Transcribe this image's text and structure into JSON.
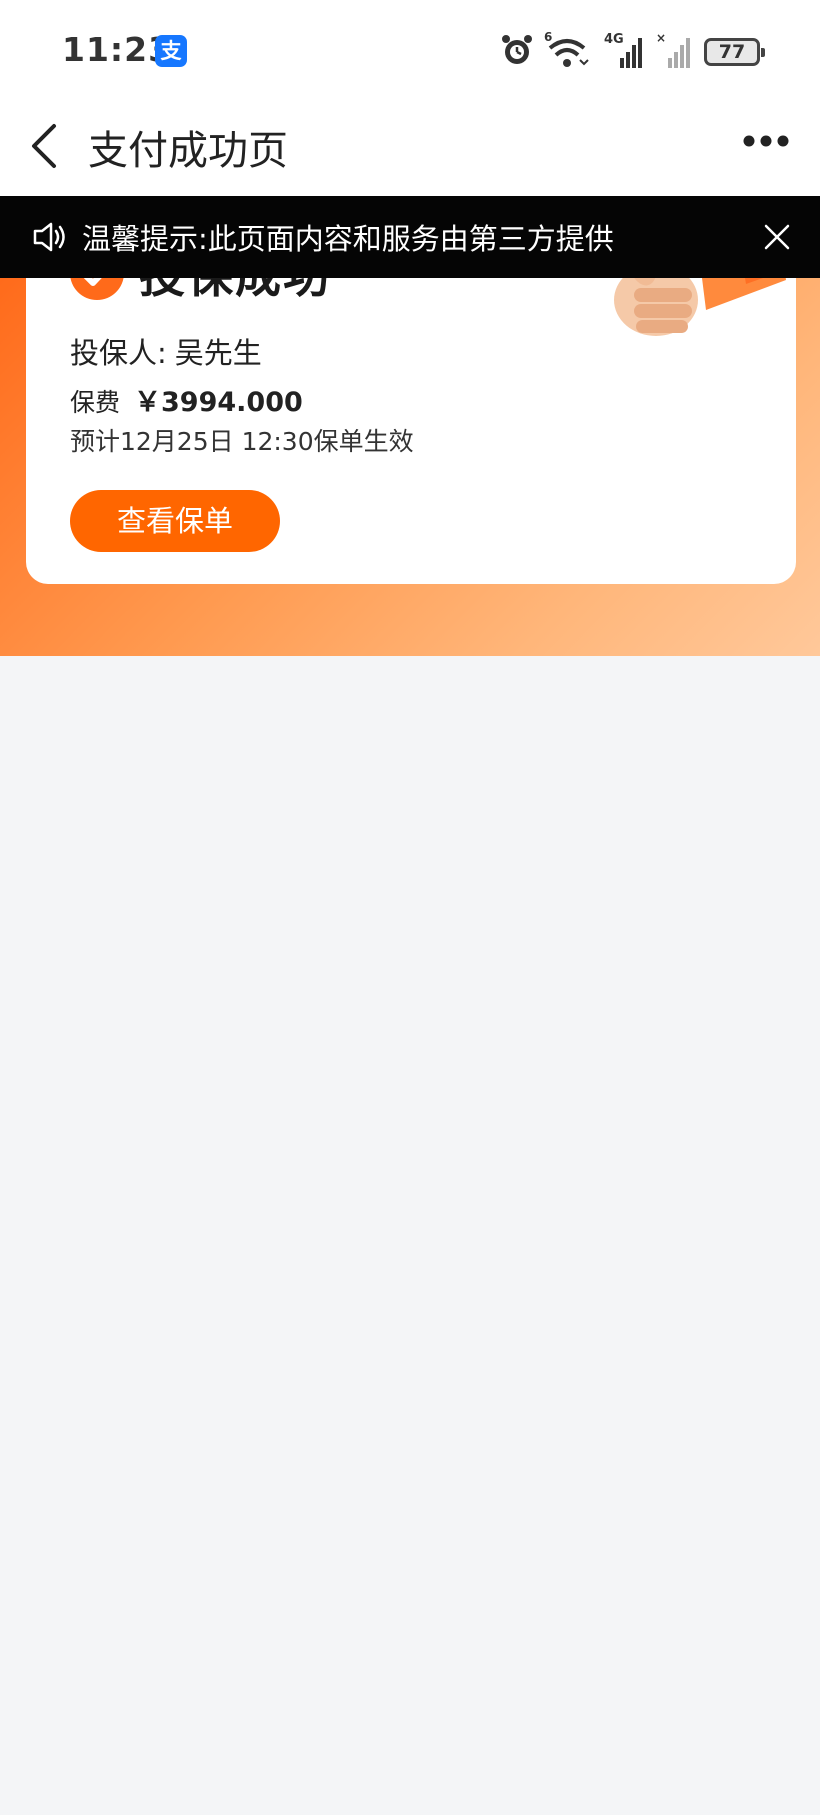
{
  "status_bar": {
    "time": "11:23",
    "app_badge": "支",
    "battery": "77",
    "network_label": "4G",
    "wifi_badge": "6"
  },
  "nav": {
    "title": "支付成功页"
  },
  "notice": {
    "text": "温馨提示:此页面内容和服务由第三方提供"
  },
  "result": {
    "title": "投保成功",
    "applicant_label": "投保人:",
    "applicant_name": "吴先生",
    "fee_label": "保费",
    "fee_amount": "￥3994.000",
    "effective_text": "预计12月25日 12:30保单生效",
    "view_button_label": "查看保单"
  },
  "colors": {
    "accent": "#ff6600",
    "banner_bg": "#050505",
    "page_bg": "#f4f5f7"
  }
}
